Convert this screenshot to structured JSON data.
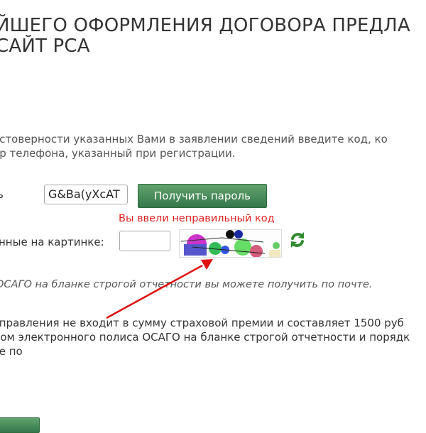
{
  "title": {
    "line1": "ЙШЕГО ОФОРМЛЕНИЯ ДОГОВОРА ПРЕДЛА",
    "line2": "САЙТ РСА"
  },
  "intro": {
    "line1": "остоверности указанных Вами в заявлении сведений введите код, ко",
    "line2": "ер телефона, указанный при регистрации."
  },
  "password": {
    "label": "ь",
    "value": "G&Ba(yXcAT",
    "button_label": "Получить пароль"
  },
  "error_message": "Вы ввели неправильный код",
  "captcha": {
    "label": "нные на картинке:",
    "input_value": ""
  },
  "notice": "ОСАГО на бланке строгой отчетности вы можете получить по почте.",
  "payment": {
    "line1": "тправления не входит в сумму страховой премии и составляет 1500 руб",
    "line2": "дом электронного полиса ОСАГО на бланке строгой отчетности и порядк",
    "line3": "те по"
  },
  "colors": {
    "button_green": "#3f8a50",
    "error_red": "#e02020",
    "arrow_red": "#e01010",
    "refresh_green": "#2e8b2e"
  },
  "icons": {
    "refresh": "refresh-icon",
    "annotation": "arrow-annotation-icon"
  }
}
